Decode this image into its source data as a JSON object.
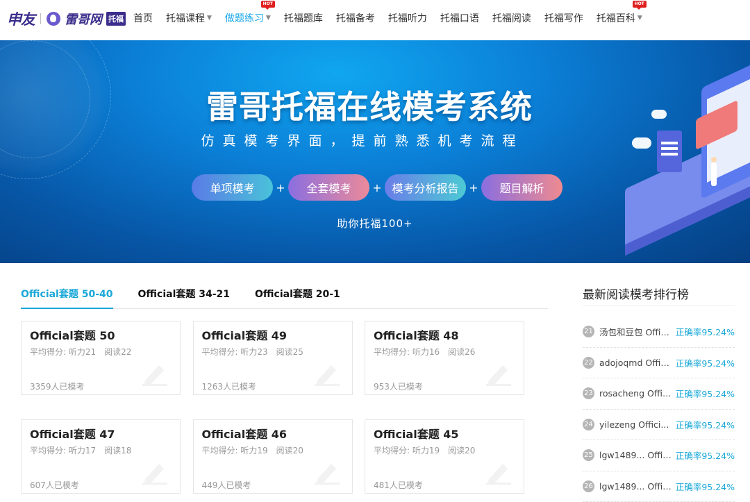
{
  "nav": {
    "logo_text": "申友",
    "brand_text": "雷哥网",
    "brand_badge": "托福",
    "items": [
      {
        "label": "首页",
        "caret": false,
        "hot": false,
        "active": false
      },
      {
        "label": "托福课程",
        "caret": true,
        "hot": false,
        "active": false
      },
      {
        "label": "做题练习",
        "caret": true,
        "hot": true,
        "active": true
      },
      {
        "label": "托福题库",
        "caret": false,
        "hot": false,
        "active": false
      },
      {
        "label": "托福备考",
        "caret": false,
        "hot": false,
        "active": false
      },
      {
        "label": "托福听力",
        "caret": false,
        "hot": false,
        "active": false
      },
      {
        "label": "托福口语",
        "caret": false,
        "hot": false,
        "active": false
      },
      {
        "label": "托福阅读",
        "caret": false,
        "hot": false,
        "active": false
      },
      {
        "label": "托福写作",
        "caret": false,
        "hot": false,
        "active": false
      },
      {
        "label": "托福百科",
        "caret": true,
        "hot": true,
        "active": false
      }
    ],
    "hot_label": "HOT",
    "active_color": "#1aa8e8"
  },
  "banner": {
    "title": "雷哥托福在线模考系统",
    "subtitle": "仿真模考界面，提前熟悉机考流程",
    "pills": [
      "单项模考",
      "全套模考",
      "模考分析报告",
      "题目解析"
    ],
    "plus": "+",
    "slogan": "助你托福100+"
  },
  "tabs": [
    {
      "label": "Official套题 50-40",
      "active": true
    },
    {
      "label": "Official套题 34-21",
      "active": false
    },
    {
      "label": "Official套题 20-1",
      "active": false
    }
  ],
  "cards": [
    {
      "title": "Official套题 50",
      "listening": "平均得分: 听力21",
      "reading": "阅读22",
      "count": "3359人已模考"
    },
    {
      "title": "Official套题 49",
      "listening": "平均得分: 听力23",
      "reading": "阅读25",
      "count": "1263人已模考"
    },
    {
      "title": "Official套题 48",
      "listening": "平均得分: 听力16",
      "reading": "阅读26",
      "count": "953人已模考"
    },
    {
      "title": "Official套题 47",
      "listening": "平均得分: 听力17",
      "reading": "阅读18",
      "count": "607人已模考"
    },
    {
      "title": "Official套题 46",
      "listening": "平均得分: 听力19",
      "reading": "阅读20",
      "count": "449人已模考"
    },
    {
      "title": "Official套题 45",
      "listening": "平均得分: 听力19",
      "reading": "阅读20",
      "count": "481人已模考"
    }
  ],
  "ranking": {
    "title": "最新阅读模考排行榜",
    "items": [
      {
        "num": "21",
        "name": "汤包和豆包 Offici...",
        "rate": "正确率95.24%"
      },
      {
        "num": "22",
        "name": "adojoqmd Offici...",
        "rate": "正确率95.24%"
      },
      {
        "num": "23",
        "name": "rosacheng Offici...",
        "rate": "正确率95.24%"
      },
      {
        "num": "24",
        "name": "yilezeng    Offici...",
        "rate": "正确率95.24%"
      },
      {
        "num": "25",
        "name": "lgw1489... Offici...",
        "rate": "正确率95.24%"
      },
      {
        "num": "26",
        "name": "lgw1489... Offici...",
        "rate": "正确率95.24%"
      }
    ]
  },
  "accent_color": "#1aa8d8"
}
